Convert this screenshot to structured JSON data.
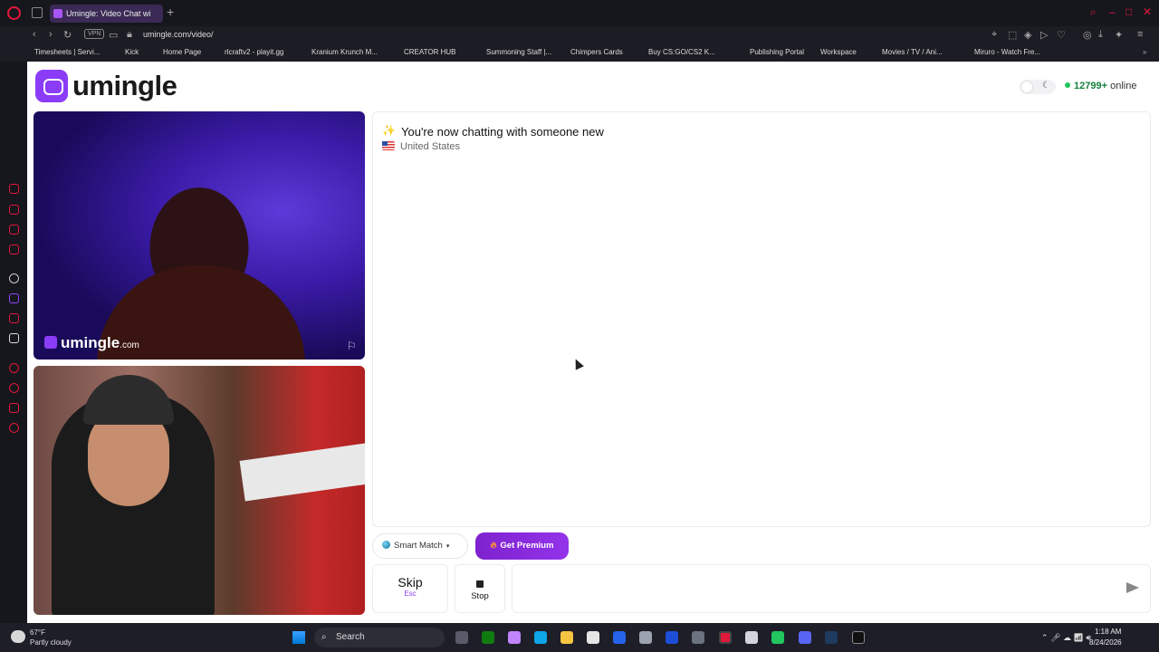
{
  "browser": {
    "tab_title": "Umingle: Video Chat wi",
    "url": "umingle.com/video/",
    "vpn_label": "VPN",
    "bookmarks": [
      "Timesheets | Servi...",
      "Kick",
      "Home Page",
      "rlcraftv2 - playit.gg",
      "Kranium Krunch M...",
      "CREATOR HUB",
      "Summoning Staff |...",
      "Chimpers Cards",
      "Buy CS:GO/CS2 K...",
      "Publishing Portal",
      "Workspace",
      "Movies / TV / Ani...",
      "Miruro - Watch Fre..."
    ]
  },
  "header": {
    "logo_text": "umingle",
    "online_count": "12799+",
    "online_label": "online"
  },
  "video": {
    "watermark_brand": "umingle",
    "watermark_tld": ".com"
  },
  "chat": {
    "status": "You're now chatting with someone new",
    "country": "United States"
  },
  "controls": {
    "smart_match_label": "Smart Match",
    "premium_label": "Get Premium",
    "skip_label": "Skip",
    "skip_hint": "Esc",
    "stop_label": "Stop",
    "message_value": ""
  },
  "taskbar": {
    "temperature": "67°F",
    "weather": "Partly cloudy",
    "search_label": "Search",
    "time": "1:18 AM",
    "date": "8/24/2026"
  },
  "colors": {
    "brand_purple": "#8b3cf6",
    "online_green": "#22c55e",
    "browser_accent": "#e0193a"
  }
}
